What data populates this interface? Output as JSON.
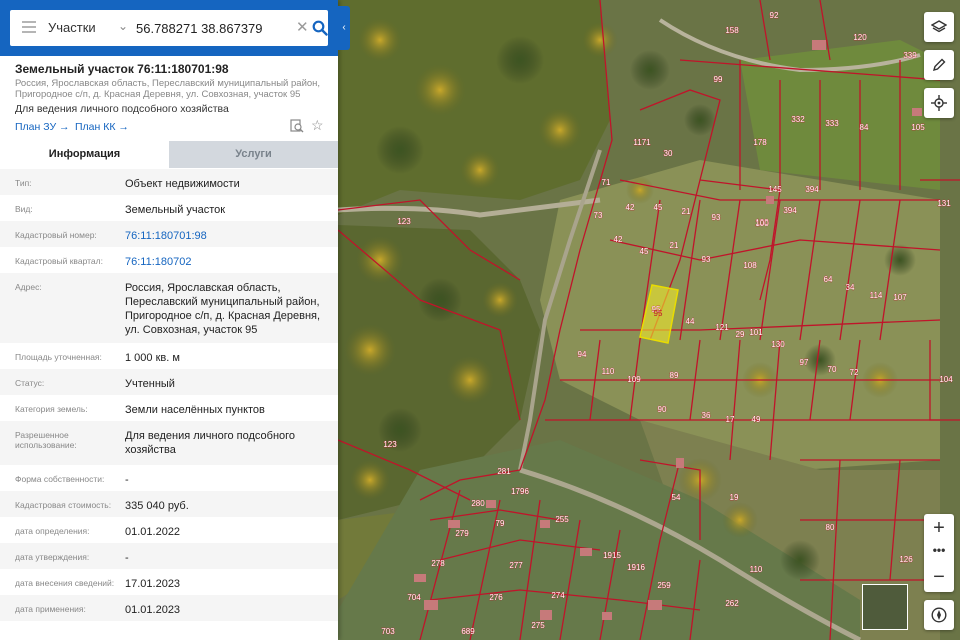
{
  "search": {
    "layer": "Участки",
    "query": "56.788271 38.867379"
  },
  "parcel": {
    "title": "Земельный участок 76:11:180701:98",
    "address": "Россия, Ярославская область, Переславский муниципальный район, Пригородное с/п, д. Красная Деревня, ул. Совхозная, участок 95",
    "use": "Для ведения личного подсобного хозяйства",
    "plan_zu": "План ЗУ →",
    "plan_kk": "План КК →"
  },
  "tabs": {
    "info": "Информация",
    "services": "Услуги"
  },
  "attributes": [
    {
      "label": "Тип:",
      "value": "Объект недвижимости"
    },
    {
      "label": "Вид:",
      "value": "Земельный участок"
    },
    {
      "label": "Кадастровый номер:",
      "value": "76:11:180701:98"
    },
    {
      "label": "Кадастровый квартал:",
      "value": "76:11:180702"
    },
    {
      "label": "Адрес:",
      "value": "Россия, Ярославская область, Переславский муниципальный район, Пригородное с/п, д. Красная Деревня, ул. Совхозная, участок 95"
    },
    {
      "label": "Площадь уточненная:",
      "value": "1 000 кв. м"
    },
    {
      "label": "Статус:",
      "value": "Учтенный"
    },
    {
      "label": "Категория земель:",
      "value": "Земли населённых пунктов"
    },
    {
      "label": "Разрешенное использование:",
      "value": "Для ведения личного подсобного хозяйства"
    },
    {
      "label": "Форма собственности:",
      "value": "-"
    },
    {
      "label": "Кадастровая стоимость:",
      "value": "335 040 руб."
    },
    {
      "label": "дата определения:",
      "value": "01.01.2022"
    },
    {
      "label": "дата утверждения:",
      "value": "-"
    },
    {
      "label": "дата внесения сведений:",
      "value": "17.01.2023"
    },
    {
      "label": "дата применения:",
      "value": "01.01.2023"
    }
  ],
  "map": {
    "selected_parcel": "95",
    "parcel_labels": [
      "158",
      "92",
      "120",
      "339",
      "99",
      "332",
      "333",
      "84",
      "105",
      "1171",
      "30",
      "178",
      "145",
      "394",
      "131",
      "71",
      "42",
      "45",
      "21",
      "93",
      "100",
      "394",
      "123",
      "73",
      "42",
      "45",
      "21",
      "93",
      "108",
      "100",
      "64",
      "34",
      "114",
      "107",
      "44",
      "121",
      "101",
      "29",
      "130",
      "97",
      "70",
      "72",
      "104",
      "94",
      "110",
      "109",
      "89",
      "90",
      "36",
      "17",
      "49",
      "123",
      "281",
      "1796",
      "280",
      "79",
      "255",
      "54",
      "19",
      "80",
      "126",
      "95",
      "279",
      "278",
      "277",
      "276",
      "274",
      "1915",
      "1916",
      "259",
      "704",
      "703",
      "689",
      "275",
      "262",
      "110"
    ]
  },
  "colors": {
    "accent": "#1565c0",
    "boundary": "#c0142a",
    "selected_fill": "#f2ea2c"
  }
}
